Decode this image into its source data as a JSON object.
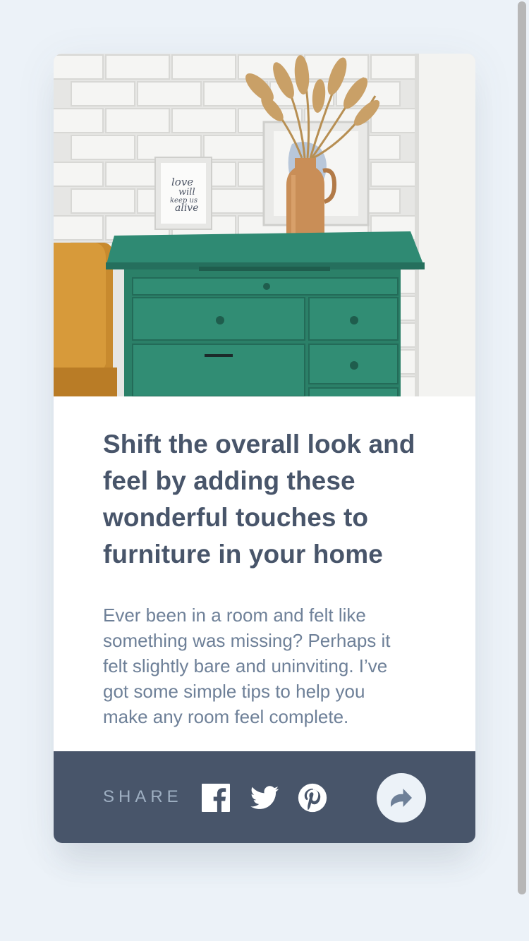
{
  "article": {
    "title": "Shift the overall look and feel by adding these wonderful touches to furniture in your home",
    "description": "Ever been in a room and felt like something was missing? Perhaps it felt slightly bare and uninviting. I’ve got some simple tips to help you make any room feel complete."
  },
  "frame_print": {
    "line1": "love",
    "line2": "will",
    "line3": "keep us",
    "line4": "alive"
  },
  "footer": {
    "share_label": "SHARE",
    "icons": [
      "facebook-icon",
      "twitter-icon",
      "pinterest-icon",
      "share-arrow-icon"
    ]
  },
  "colors": {
    "background": "#ecf2f8",
    "card": "#ffffff",
    "title": "#48556a",
    "description": "#6e8098",
    "footer": "#48556a",
    "share_label": "#9eafc2",
    "share_button": "#ecf2f8",
    "share_arrow": "#6e8098"
  }
}
